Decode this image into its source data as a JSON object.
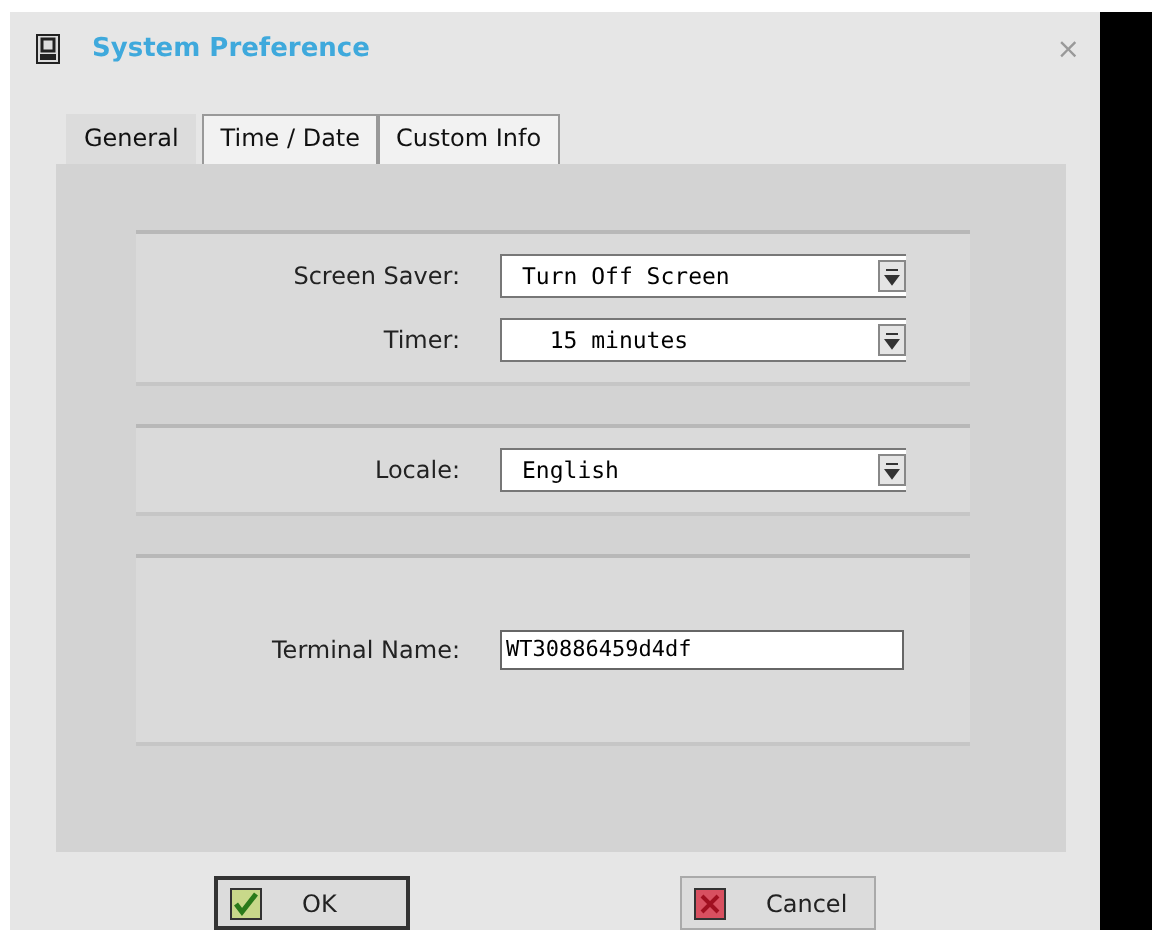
{
  "window": {
    "title": "System Preference",
    "close": "×"
  },
  "tabs": [
    {
      "label": "General",
      "selected": true
    },
    {
      "label": "Time / Date",
      "selected": false
    },
    {
      "label": "Custom Info",
      "selected": false
    }
  ],
  "groups": [
    {
      "fields": [
        {
          "kind": "dropdown",
          "label": "Screen Saver:",
          "value": "Turn Off Screen"
        },
        {
          "kind": "dropdown",
          "label": "Timer:",
          "value": "  15 minutes"
        }
      ]
    },
    {
      "fields": [
        {
          "kind": "dropdown",
          "label": "Locale:",
          "value": "English"
        }
      ]
    },
    {
      "fields": [
        {
          "kind": "text",
          "label": "Terminal Name:",
          "value": "WT30886459d4df"
        }
      ]
    }
  ],
  "buttons": [
    {
      "kind": "ok",
      "label": "OK"
    },
    {
      "kind": "cancel",
      "label": "Cancel"
    }
  ]
}
